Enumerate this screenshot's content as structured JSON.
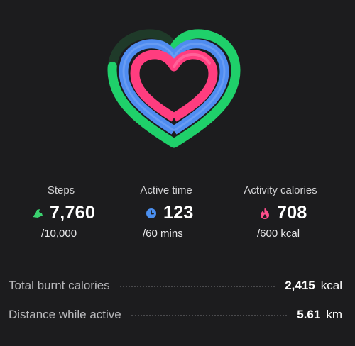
{
  "rings": {
    "steps_progress": 0.776,
    "active_time_progress": 1.0,
    "calories_progress": 1.0,
    "colors": {
      "steps": "#1fd06a",
      "steps_track": "#1f3a29",
      "active_time": "#4f8cf0",
      "calories": "#ff3d7f"
    }
  },
  "stats": [
    {
      "label": "Steps",
      "icon": "shoe-icon",
      "icon_color": "#3ad16f",
      "value": "7,760",
      "goal": "/10,000"
    },
    {
      "label": "Active time",
      "icon": "clock-icon",
      "icon_color": "#4b8fef",
      "value": "123",
      "goal": "/60 mins"
    },
    {
      "label": "Activity calories",
      "icon": "flame-icon",
      "icon_color": "#ff4e8b",
      "value": "708",
      "goal": "/600 kcal"
    }
  ],
  "summary": {
    "total_burnt": {
      "label": "Total burnt calories",
      "value": "2,415",
      "unit": "kcal"
    },
    "distance": {
      "label": "Distance while active",
      "value": "5.61",
      "unit": "km"
    }
  }
}
